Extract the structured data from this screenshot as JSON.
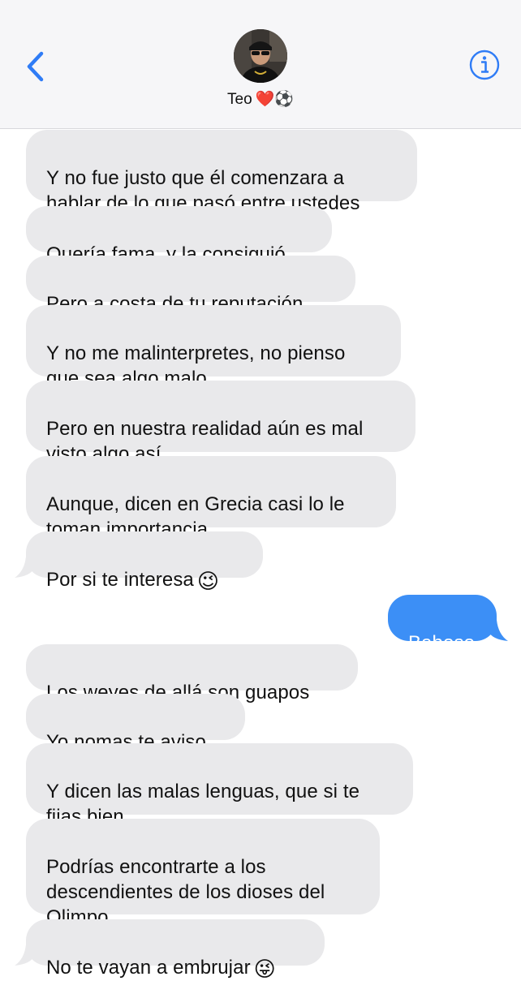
{
  "header": {
    "contact_name": "Teo",
    "contact_emojis": "❤️⚽",
    "back_icon": "chevron-left-icon",
    "info_icon": "info-circle-icon"
  },
  "colors": {
    "received_bubble": "#e9e9eb",
    "sent_bubble": "#3c8ff6",
    "accent": "#2f7cf6",
    "header_bg": "#f6f6f8"
  },
  "messages": [
    {
      "from": "contact",
      "text": "Y no fue justo que él comenzara a\nhablar de lo que pasó entre ustedes"
    },
    {
      "from": "contact",
      "text": "Quería fama, y la consiguió"
    },
    {
      "from": "contact",
      "text": "Pero a costa de tu reputación"
    },
    {
      "from": "contact",
      "text": "Y no me malinterpretes, no pienso\nque sea algo malo"
    },
    {
      "from": "contact",
      "text": "Pero en nuestra realidad aún es mal\nvisto algo así"
    },
    {
      "from": "contact",
      "text": "Aunque, dicen en Grecia casi lo le\ntoman importancia"
    },
    {
      "from": "contact",
      "text": "Por si te interesa",
      "emoji": "😉"
    },
    {
      "from": "me",
      "text": "Baboso"
    },
    {
      "from": "contact",
      "text": "Los weyes de allá son guapos"
    },
    {
      "from": "contact",
      "text": "Yo nomas te aviso"
    },
    {
      "from": "contact",
      "text": "Y dicen las malas lenguas, que si te\nfijas bien"
    },
    {
      "from": "contact",
      "text": "Podrías encontrarte a los\ndescendientes de los dioses del\nOlimpo"
    },
    {
      "from": "contact",
      "text": "No te vayan a embrujar",
      "emoji": "😜"
    }
  ]
}
